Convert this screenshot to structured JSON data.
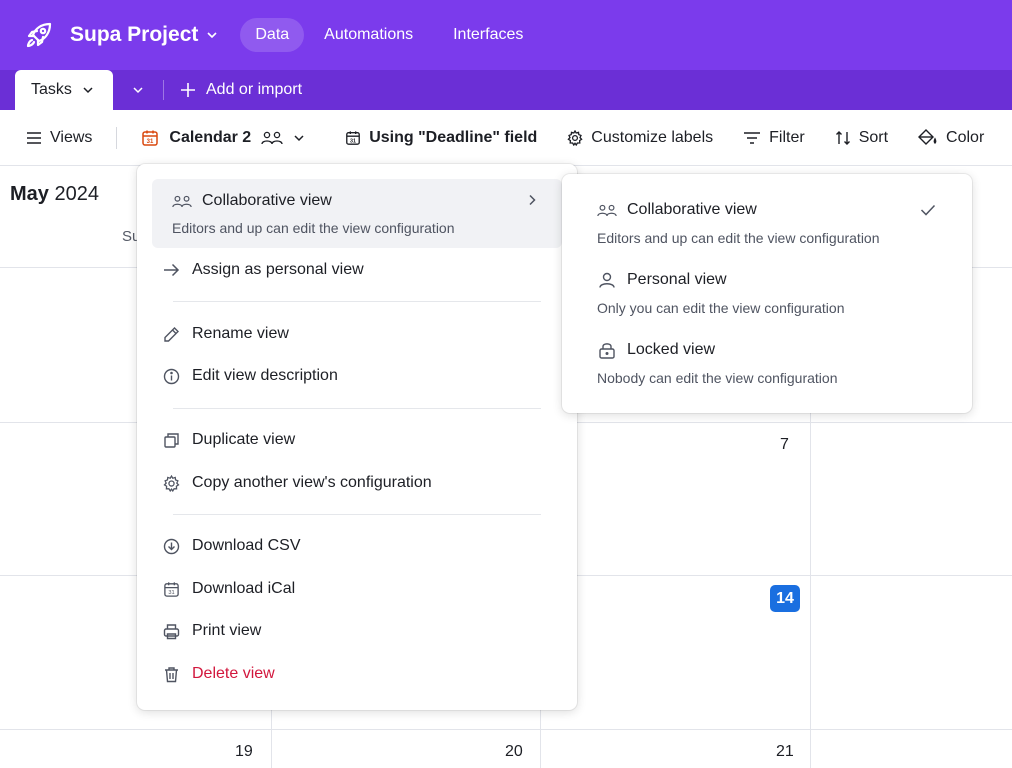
{
  "header": {
    "project_title": "Supa Project",
    "nav": [
      {
        "label": "Data",
        "active": true
      },
      {
        "label": "Automations",
        "active": false
      },
      {
        "label": "Interfaces",
        "active": false
      }
    ]
  },
  "tabs": {
    "active_tab": "Tasks",
    "add_import": "Add or import"
  },
  "toolbar": {
    "views": "Views",
    "view_name": "Calendar 2",
    "date_field": "Using \"Deadline\" field",
    "customize": "Customize labels",
    "filter": "Filter",
    "sort": "Sort",
    "color": "Color"
  },
  "calendar": {
    "month": "May",
    "year": "2024",
    "weekday_partial": "Su",
    "dates": {
      "d7": "7",
      "d14": "14",
      "d19": "19",
      "d20": "20",
      "d21": "21"
    }
  },
  "view_menu": {
    "collab_label": "Collaborative view",
    "collab_desc": "Editors and up can edit the view configuration",
    "assign_personal": "Assign as personal view",
    "rename": "Rename view",
    "edit_description": "Edit view description",
    "duplicate": "Duplicate view",
    "copy_config": "Copy another view's configuration",
    "download_csv": "Download CSV",
    "download_ical": "Download iCal",
    "print": "Print view",
    "delete": "Delete view"
  },
  "permission_submenu": {
    "items": [
      {
        "label": "Collaborative view",
        "desc": "Editors and up can edit the view configuration",
        "selected": true
      },
      {
        "label": "Personal view",
        "desc": "Only you can edit the view configuration",
        "selected": false
      },
      {
        "label": "Locked view",
        "desc": "Nobody can edit the view configuration",
        "selected": false
      }
    ]
  },
  "colors": {
    "brand_purple": "#7b3bec",
    "tab_bar": "#6b2fd6",
    "today_blue": "#1a6fe0",
    "danger": "#d2173d"
  }
}
